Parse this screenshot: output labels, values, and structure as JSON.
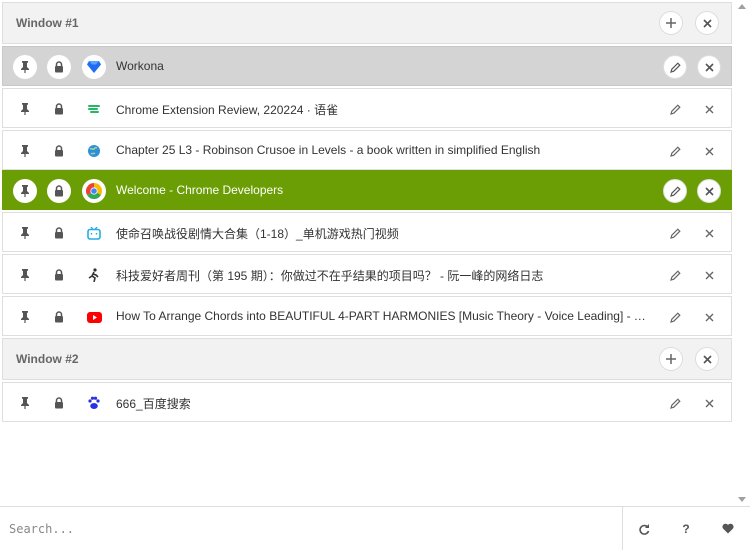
{
  "windows": [
    {
      "title": "Window #1",
      "tabs": [
        {
          "title": "Workona",
          "favicon": "workona-diamond-icon"
        },
        {
          "title": "Chrome Extension Review, 220224 · 语雀",
          "favicon": "yuque-icon"
        },
        {
          "title": "Chapter 25 L3 - Robinson Crusoe in Levels - a book written in simplified English",
          "favicon": "globe-icon"
        },
        {
          "title": "Welcome - Chrome Developers",
          "favicon": "chrome-icon"
        },
        {
          "title": "使命召唤战役剧情大合集（1-18）_单机游戏热门视频",
          "favicon": "bilibili-icon"
        },
        {
          "title": "科技爱好者周刊（第 195 期）：你做过不在乎结果的项目吗？ - 阮一峰的网络日志",
          "favicon": "runner-icon"
        },
        {
          "title": "How To Arrange Chords into BEAUTIFUL 4-PART HARMONIES [Music Theory - Voice Leading] - YouTube",
          "favicon": "youtube-icon"
        }
      ]
    },
    {
      "title": "Window #2",
      "tabs": [
        {
          "title": "666_百度搜索",
          "favicon": "baidu-paw-icon"
        }
      ]
    }
  ],
  "footer": {
    "search_placeholder": "Search...",
    "help_label": "?"
  },
  "colors": {
    "active_tab": "#6a9e04",
    "hover_tab": "#d4d4d4",
    "header_bg": "#f2f2f2",
    "youtube_red": "#ff0000",
    "workona_blue": "#1f6cf5"
  }
}
